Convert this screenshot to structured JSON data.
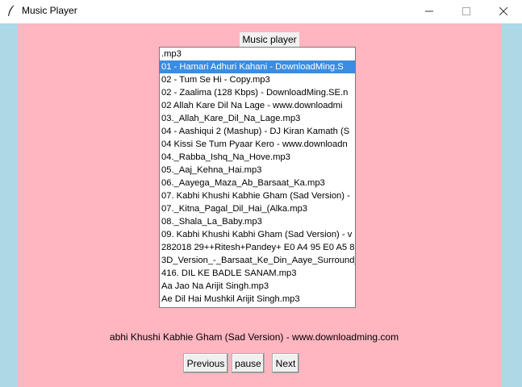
{
  "window": {
    "title": "Music Player"
  },
  "colors": {
    "background": "#add8e6",
    "panel": "#ffb6c1",
    "selection": "#3a8de0"
  },
  "header_label": "Music player",
  "playlist": {
    "selected_index": 1,
    "items": [
      ".mp3",
      "01 - Hamari Adhuri Kahani - DownloadMing.S",
      "02 - Tum Se Hi - Copy.mp3",
      "02 - Zaalima (128 Kbps) - DownloadMing.SE.n",
      "02 Allah Kare Dil Na Lage - www.downloadmi",
      "03._Allah_Kare_Dil_Na_Lage.mp3",
      "04 - Aashiqui 2 (Mashup) - DJ Kiran Kamath (S",
      "04 Kissi Se Tum Pyaar Kero - www.downloadn",
      "04._Rabba_Ishq_Na_Hove.mp3",
      "05._Aaj_Kehna_Hai.mp3",
      "06._Aayega_Maza_Ab_Barsaat_Ka.mp3",
      "07. Kabhi Khushi Kabhie Gham (Sad Version) -",
      "07._Kitna_Pagal_Dil_Hai_(Alka.mp3",
      "08._Shala_La_Baby.mp3",
      "09. Kabhi Khushi Kabhi Gham (Sad Version) - v",
      "282018 29++Ritesh+Pandey+ E0 A4 95 E0 A5 8",
      "3D_Version_-_Barsaat_Ke_Din_Aaye_Surround_",
      "416. DIL KE BADLE SANAM.mp3",
      "Aa Jao Na Arijit Singh.mp3",
      "Ae Dil Hai Mushkil Arijit Singh.mp3"
    ]
  },
  "now_playing": "abhi Khushi Kabhie Gham (Sad Version) - www.downloadming.com",
  "controls": {
    "previous_label": "Previous",
    "pause_label": "pause",
    "next_label": "Next"
  }
}
